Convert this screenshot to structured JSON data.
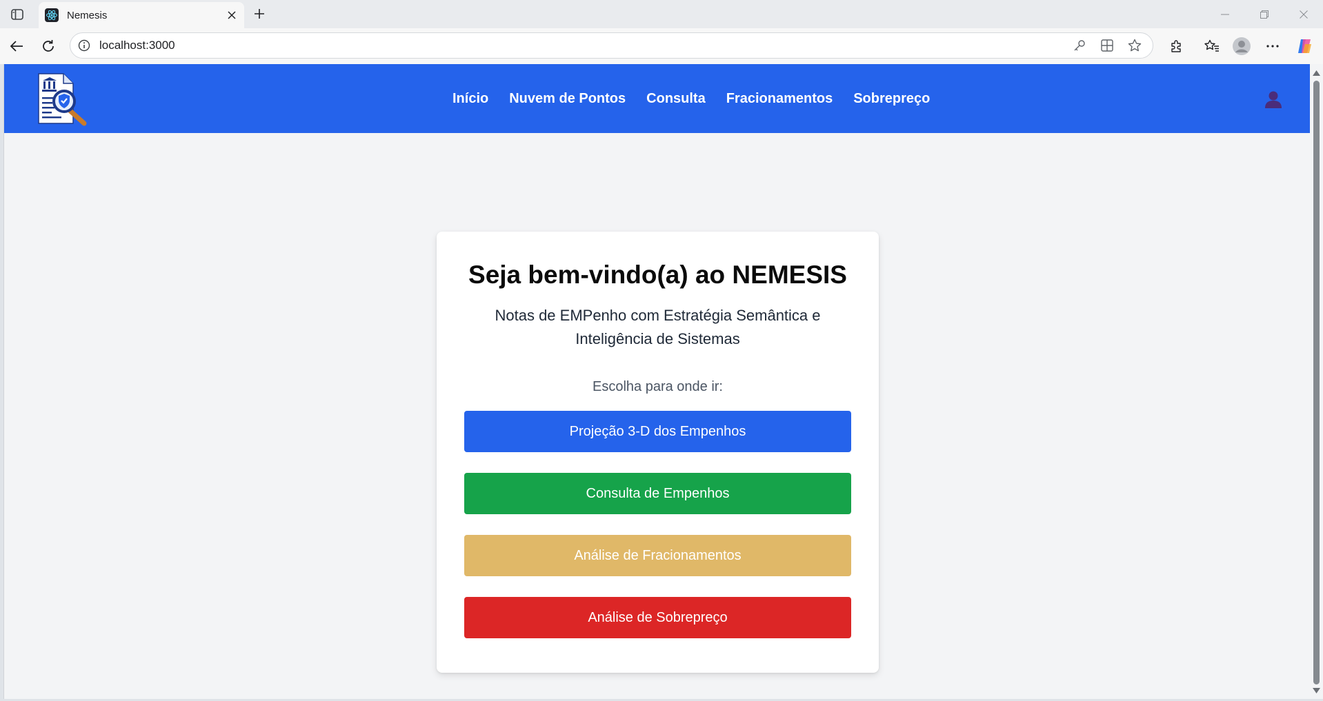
{
  "browser": {
    "tab_title": "Nemesis",
    "url": "localhost:3000"
  },
  "app": {
    "nav": [
      "Início",
      "Nuvem de Pontos",
      "Consulta",
      "Fracionamentos",
      "Sobrepreço"
    ],
    "header_color": "#2563eb"
  },
  "welcome": {
    "title": "Seja bem-vindo(a) ao NEMESIS",
    "subtitle": "Notas de EMPenho com Estratégia Semântica e Inteligência de Sistemas",
    "prompt": "Escolha para onde ir:",
    "buttons": [
      {
        "label": "Projeção 3-D dos Empenhos",
        "color": "#2563eb"
      },
      {
        "label": "Consulta de Empenhos",
        "color": "#16a34a"
      },
      {
        "label": "Análise de Fracionamentos",
        "color": "#e0b868"
      },
      {
        "label": "Análise de Sobrepreço",
        "color": "#dc2626"
      }
    ]
  }
}
